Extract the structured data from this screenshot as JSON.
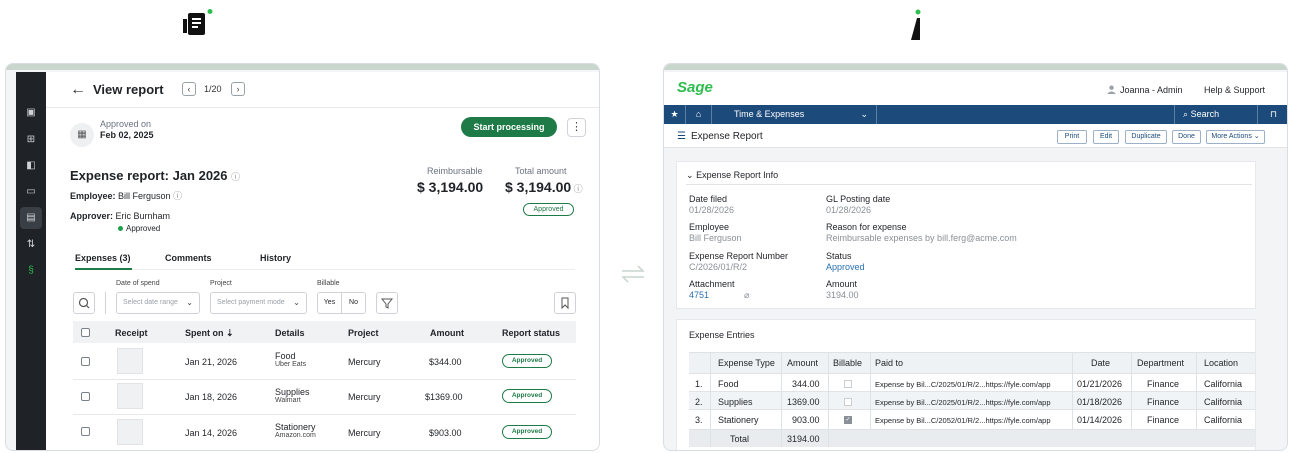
{
  "fyle": {
    "logo_icon": "fyle-logo-icon",
    "view_title": "View report",
    "pagination": "1/20",
    "approved_label": "Approved on",
    "approved_date": "Feb 02, 2025",
    "start_button": "Start processing",
    "kebab": "⋮",
    "report_title": "Expense report: Jan 2026",
    "employee_label": "Employee:",
    "employee_name": "Bill Ferguson",
    "approver_label": "Approver:",
    "approver_name": "Eric Burnham",
    "approver_status": "Approved",
    "reimbursable_label": "Reimbursable",
    "reimbursable_value": "$ 3,194.00",
    "total_label": "Total amount",
    "total_value": "$ 3,194.00",
    "report_status": "Approved",
    "tabs": [
      "Expenses (3)",
      "Comments",
      "History"
    ],
    "filters": {
      "date_label": "Date of spend",
      "date_placeholder": "Select date range",
      "project_label": "Project",
      "project_placeholder": "Select payment mode",
      "billable_label": "Billable",
      "yes": "Yes",
      "no": "No"
    },
    "columns": [
      "Receipt",
      "Spent on",
      "Details",
      "Project",
      "Amount",
      "Report status"
    ],
    "rows": [
      {
        "date": "Jan 21, 2026",
        "category": "Food",
        "merchant": "Uber Eats",
        "project": "Mercury",
        "amount": "$344.00",
        "status": "Approved"
      },
      {
        "date": "Jan 18, 2026",
        "category": "Supplies",
        "merchant": "Walmart",
        "project": "Mercury",
        "amount": "$1369.00",
        "status": "Approved"
      },
      {
        "date": "Jan 14, 2026",
        "category": "Stationery",
        "merchant": "Amazon.com",
        "project": "Mercury",
        "amount": "$903.00",
        "status": "Approved"
      }
    ],
    "accent": "#1e7a46"
  },
  "sage": {
    "logo": "Sage",
    "user": "Joanna - Admin",
    "help": "Help & Support",
    "nav_module": "Time & Expenses",
    "nav_search": "Search",
    "page_title": "Expense Report",
    "actions": [
      "Print",
      "Edit",
      "Duplicate",
      "Done",
      "More Actions ⌄"
    ],
    "info_header": "Expense Report Info",
    "fields": {
      "date_filed_label": "Date filed",
      "date_filed": "01/28/2026",
      "gl_label": "GL Posting date",
      "gl": "01/28/2026",
      "employee_label": "Employee",
      "employee": "Bill Ferguson",
      "reason_label": "Reason for expense",
      "reason": "Reimbursable expenses by bill.ferg@acme.com",
      "number_label": "Expense Report Number",
      "number": "C/2026/01/R/2",
      "status_label": "Status",
      "status": "Approved",
      "attachment_label": "Attachment",
      "attachment": "4751",
      "amount_label": "Amount",
      "amount": "3194.00"
    },
    "entries_header": "Expense Entries",
    "columns": [
      "Expense Type",
      "Amount",
      "Billable",
      "Paid to",
      "Date",
      "Department",
      "Location"
    ],
    "rows": [
      {
        "n": "1.",
        "type": "Food",
        "amount": "344.00",
        "billable": false,
        "paid_to": "Expense by Bil...C/2025/01/R/2...https://fyle.com/app",
        "date": "01/21/2026",
        "dept": "Finance",
        "loc": "California"
      },
      {
        "n": "2.",
        "type": "Supplies",
        "amount": "1369.00",
        "billable": false,
        "paid_to": "Expense by Bil...C/2025/01/R/2...https://fyle.com/app",
        "date": "01/18/2026",
        "dept": "Finance",
        "loc": "California"
      },
      {
        "n": "3.",
        "type": "Stationery",
        "amount": "903.00",
        "billable": true,
        "paid_to": "Expense by Bil...C/2052/01/R/2...https://fyle.com/app",
        "date": "01/14/2026",
        "dept": "Finance",
        "loc": "California"
      }
    ],
    "total_label": "Total",
    "total_amount": "3194.00",
    "nav_color": "#1c4a7a",
    "brand_color": "#2ebd4f"
  }
}
